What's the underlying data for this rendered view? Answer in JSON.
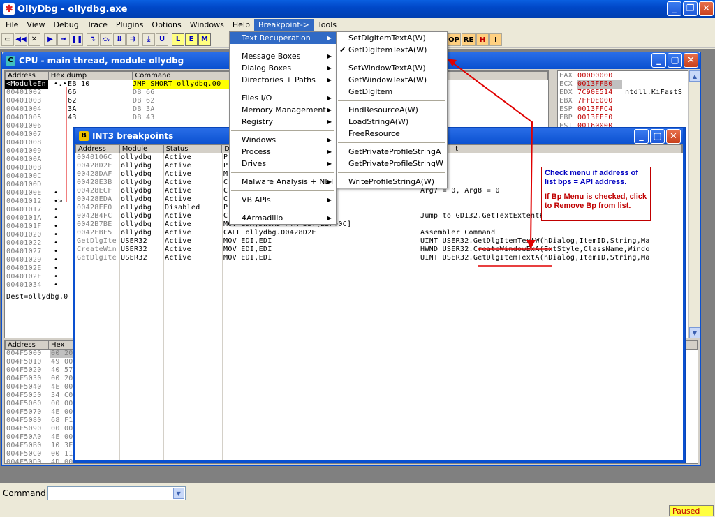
{
  "app": {
    "title": "OllyDbg - ollydbg.exe"
  },
  "menubar": [
    "File",
    "View",
    "Debug",
    "Trace",
    "Plugins",
    "Options",
    "Windows",
    "Help",
    "Breakpoint->",
    "Tools"
  ],
  "toolbar_letters": [
    "L",
    "E",
    "M",
    "OP",
    "RE",
    "H",
    "I"
  ],
  "cpu": {
    "title": "CPU - main thread, module ollydbg",
    "headers": {
      "address": "Address",
      "hex": "Hex dump",
      "command": "Command"
    },
    "rows": [
      {
        "addr": "<ModuleEn",
        "mark": "•.•",
        "hex": "EB 10",
        "cmd": "JMP SHORT ollydbg.00"
      },
      {
        "addr": "00401002",
        "mark": "",
        "hex": "66",
        "cmd": "DB 66"
      },
      {
        "addr": "00401003",
        "mark": "",
        "hex": "62",
        "cmd": "DB 62"
      },
      {
        "addr": "00401004",
        "mark": "",
        "hex": "3A",
        "cmd": "DB 3A"
      },
      {
        "addr": "00401005",
        "mark": "",
        "hex": "43",
        "cmd": "DB 43"
      },
      {
        "addr": "00401006",
        "mark": "",
        "hex": "",
        "cmd": ""
      },
      {
        "addr": "00401007",
        "mark": "",
        "hex": "",
        "cmd": ""
      },
      {
        "addr": "00401008",
        "mark": "",
        "hex": "",
        "cmd": ""
      },
      {
        "addr": "00401009",
        "mark": "",
        "hex": "",
        "cmd": ""
      },
      {
        "addr": "0040100A",
        "mark": "",
        "hex": "",
        "cmd": ""
      },
      {
        "addr": "0040100B",
        "mark": "",
        "hex": "",
        "cmd": ""
      },
      {
        "addr": "0040100C",
        "mark": "",
        "hex": "",
        "cmd": ""
      },
      {
        "addr": "0040100D",
        "mark": "",
        "hex": "",
        "cmd": ""
      },
      {
        "addr": "0040100E",
        "mark": "•",
        "hex": "",
        "cmd": ""
      },
      {
        "addr": "00401012",
        "mark": "•>",
        "hex": "",
        "cmd": ""
      },
      {
        "addr": "00401017",
        "mark": "•",
        "hex": "",
        "cmd": ""
      },
      {
        "addr": "0040101A",
        "mark": "•",
        "hex": "",
        "cmd": ""
      },
      {
        "addr": "0040101F",
        "mark": "•",
        "hex": "",
        "cmd": ""
      },
      {
        "addr": "00401020",
        "mark": "•",
        "hex": "",
        "cmd": ""
      },
      {
        "addr": "00401022",
        "mark": "•",
        "hex": "",
        "cmd": ""
      },
      {
        "addr": "00401027",
        "mark": "•",
        "hex": "",
        "cmd": ""
      },
      {
        "addr": "00401029",
        "mark": "•",
        "hex": "",
        "cmd": ""
      },
      {
        "addr": "0040102E",
        "mark": "•",
        "hex": "",
        "cmd": ""
      },
      {
        "addr": "0040102F",
        "mark": "•",
        "hex": "",
        "cmd": ""
      },
      {
        "addr": "00401034",
        "mark": "•",
        "hex": "",
        "cmd": ""
      }
    ],
    "info": "Dest=ollydbg.0",
    "registers": [
      {
        "name": "EAX",
        "val": "00000000",
        "extra": ""
      },
      {
        "name": "ECX",
        "val": "0013FFB0",
        "extra": ""
      },
      {
        "name": "EDX",
        "val": "7C90E514",
        "extra": "ntdll.KiFastS"
      },
      {
        "name": "EBX",
        "val": "7FFDE000",
        "extra": ""
      },
      {
        "name": "ESP",
        "val": "0013FFC4",
        "extra": ""
      },
      {
        "name": "EBP",
        "val": "0013FFF0",
        "extra": ""
      },
      {
        "name": "ESI",
        "val": "00160000",
        "extra": ""
      }
    ],
    "dump_headers": {
      "address": "Address",
      "hex": "Hex"
    },
    "dump_rows": [
      {
        "addr": "004F5000",
        "hex": "00 20"
      },
      {
        "addr": "004F5010",
        "hex": "49 00"
      },
      {
        "addr": "004F5020",
        "hex": "40 57"
      },
      {
        "addr": "004F5030",
        "hex": "00 20"
      },
      {
        "addr": "004F5040",
        "hex": "4E 00"
      },
      {
        "addr": "004F5050",
        "hex": "34 C0"
      },
      {
        "addr": "004F5060",
        "hex": "00 00"
      },
      {
        "addr": "004F5070",
        "hex": "4E 00"
      },
      {
        "addr": "004F5080",
        "hex": "68 F1"
      },
      {
        "addr": "004F5090",
        "hex": "00 00"
      },
      {
        "addr": "004F50A0",
        "hex": "4E 00"
      },
      {
        "addr": "004F50B0",
        "hex": "10 3E"
      },
      {
        "addr": "004F50C0",
        "hex": "00 11"
      },
      {
        "addr": "004F50D0",
        "hex": "4D 00"
      }
    ]
  },
  "bp": {
    "title": "INT3 breakpoints",
    "headers": {
      "address": "Address",
      "module": "Module",
      "status": "Status",
      "disasm": "D",
      "comment": "t"
    },
    "rows": [
      {
        "addr": "0040106C",
        "mod": "ollydbg",
        "status": "Active",
        "dis": "P",
        "cmt": "",
        "gray": true
      },
      {
        "addr": "00428D2E",
        "mod": "ollydbg",
        "status": "Active",
        "dis": "P",
        "cmt": "",
        "gray": true
      },
      {
        "addr": "00428DAF",
        "mod": "ollydbg",
        "status": "Active",
        "dis": "M",
        "cmt": "",
        "gray": true
      },
      {
        "addr": "00428E3B",
        "mod": "ollydbg",
        "status": "Active",
        "dis": "C",
        "cmt": "",
        "gray": true
      },
      {
        "addr": "00428ECF",
        "mod": "ollydbg",
        "status": "Active",
        "dis": "C",
        "cmt": "Arg7 = 0, Arg8 = 0",
        "gray": true
      },
      {
        "addr": "00428EDA",
        "mod": "ollydbg",
        "status": "Active",
        "dis": "C                    ,0",
        "cmt": "",
        "gray": true
      },
      {
        "addr": "00428EE0",
        "mod": "ollydbg",
        "status": "Disabled",
        "dis": "P                    ED07",
        "cmt": "",
        "gray": true
      },
      {
        "addr": "0042B4FC",
        "mod": "ollydbg",
        "status": "Active",
        "dis": "C              ExtentPoint32W>",
        "cmt": "Jump to GDI32.GetTextExtentPoint32W",
        "gray": true
      },
      {
        "addr": "0042B7BE",
        "mod": "ollydbg",
        "status": "Active",
        "dis": "MOV EDX,DWORD PTR SS:[EBP+0C]",
        "cmt": "",
        "gray": true
      },
      {
        "addr": "0042EBF5",
        "mod": "ollydbg",
        "status": "Active",
        "dis": "CALL ollydbg.00428D2E",
        "cmt": "Assembler Command",
        "gray": true
      },
      {
        "addr": "GetDlgIte",
        "mod": "USER32",
        "status": "Active",
        "dis": "MOV EDI,EDI",
        "cmt": "UINT USER32.GetDlgItemTextW(hDialog,ItemID,String,Ma",
        "gray": true
      },
      {
        "addr": "CreateWin",
        "mod": "USER32",
        "status": "Active",
        "dis": "MOV EDI,EDI",
        "cmt": "HWND USER32.CreateWindowExA(ExtStyle,ClassName,Windo",
        "gray": true
      },
      {
        "addr": "GetDlgIte",
        "mod": "USER32",
        "status": "Active",
        "dis": "MOV EDI,EDI",
        "cmt": "UINT USER32.GetDlgItemTextA(hDialog,ItemID,String,Ma",
        "gray": true
      }
    ]
  },
  "bp_menu": [
    {
      "label": "Text Recuperation",
      "sub": true,
      "hi": true
    },
    {
      "sep": true
    },
    {
      "label": "Message Boxes",
      "sub": true
    },
    {
      "label": "Dialog Boxes",
      "sub": true
    },
    {
      "label": "Directories + Paths",
      "sub": true
    },
    {
      "sep": true
    },
    {
      "label": "Files I/O",
      "sub": true
    },
    {
      "label": "Memory Management",
      "sub": true
    },
    {
      "label": "Registry",
      "sub": true
    },
    {
      "sep": true
    },
    {
      "label": "Windows",
      "sub": true
    },
    {
      "label": "Process",
      "sub": true
    },
    {
      "label": "Drives",
      "sub": true
    },
    {
      "sep": true
    },
    {
      "label": "Malware Analysis + NET",
      "sub": true
    },
    {
      "sep": true
    },
    {
      "label": "VB APIs",
      "sub": true
    },
    {
      "sep": true
    },
    {
      "label": "4Armadillo",
      "sub": true
    }
  ],
  "text_menu": [
    {
      "label": "SetDlgItemTextA(W)"
    },
    {
      "label": "GetDlgItemTextA(W)",
      "checked": true
    },
    {
      "sep": true
    },
    {
      "label": "SetWindowTextA(W)"
    },
    {
      "label": "GetWindowTextA(W)"
    },
    {
      "label": "GetDlgItem"
    },
    {
      "sep": true
    },
    {
      "label": "FindResourceA(W)"
    },
    {
      "label": "LoadStringA(W)"
    },
    {
      "label": "FreeResource"
    },
    {
      "sep": true
    },
    {
      "label": "GetPrivateProfileStringA"
    },
    {
      "label": "GetPrivateProfileStringW"
    },
    {
      "sep": true
    },
    {
      "label": "WriteProfileStringA(W)"
    }
  ],
  "annotation": {
    "line1": "Check menu if address of list bps = API address.",
    "line2": "If Bp Menu is checked, click to Remove Bp from list."
  },
  "command_label": "Command",
  "status": "Paused"
}
